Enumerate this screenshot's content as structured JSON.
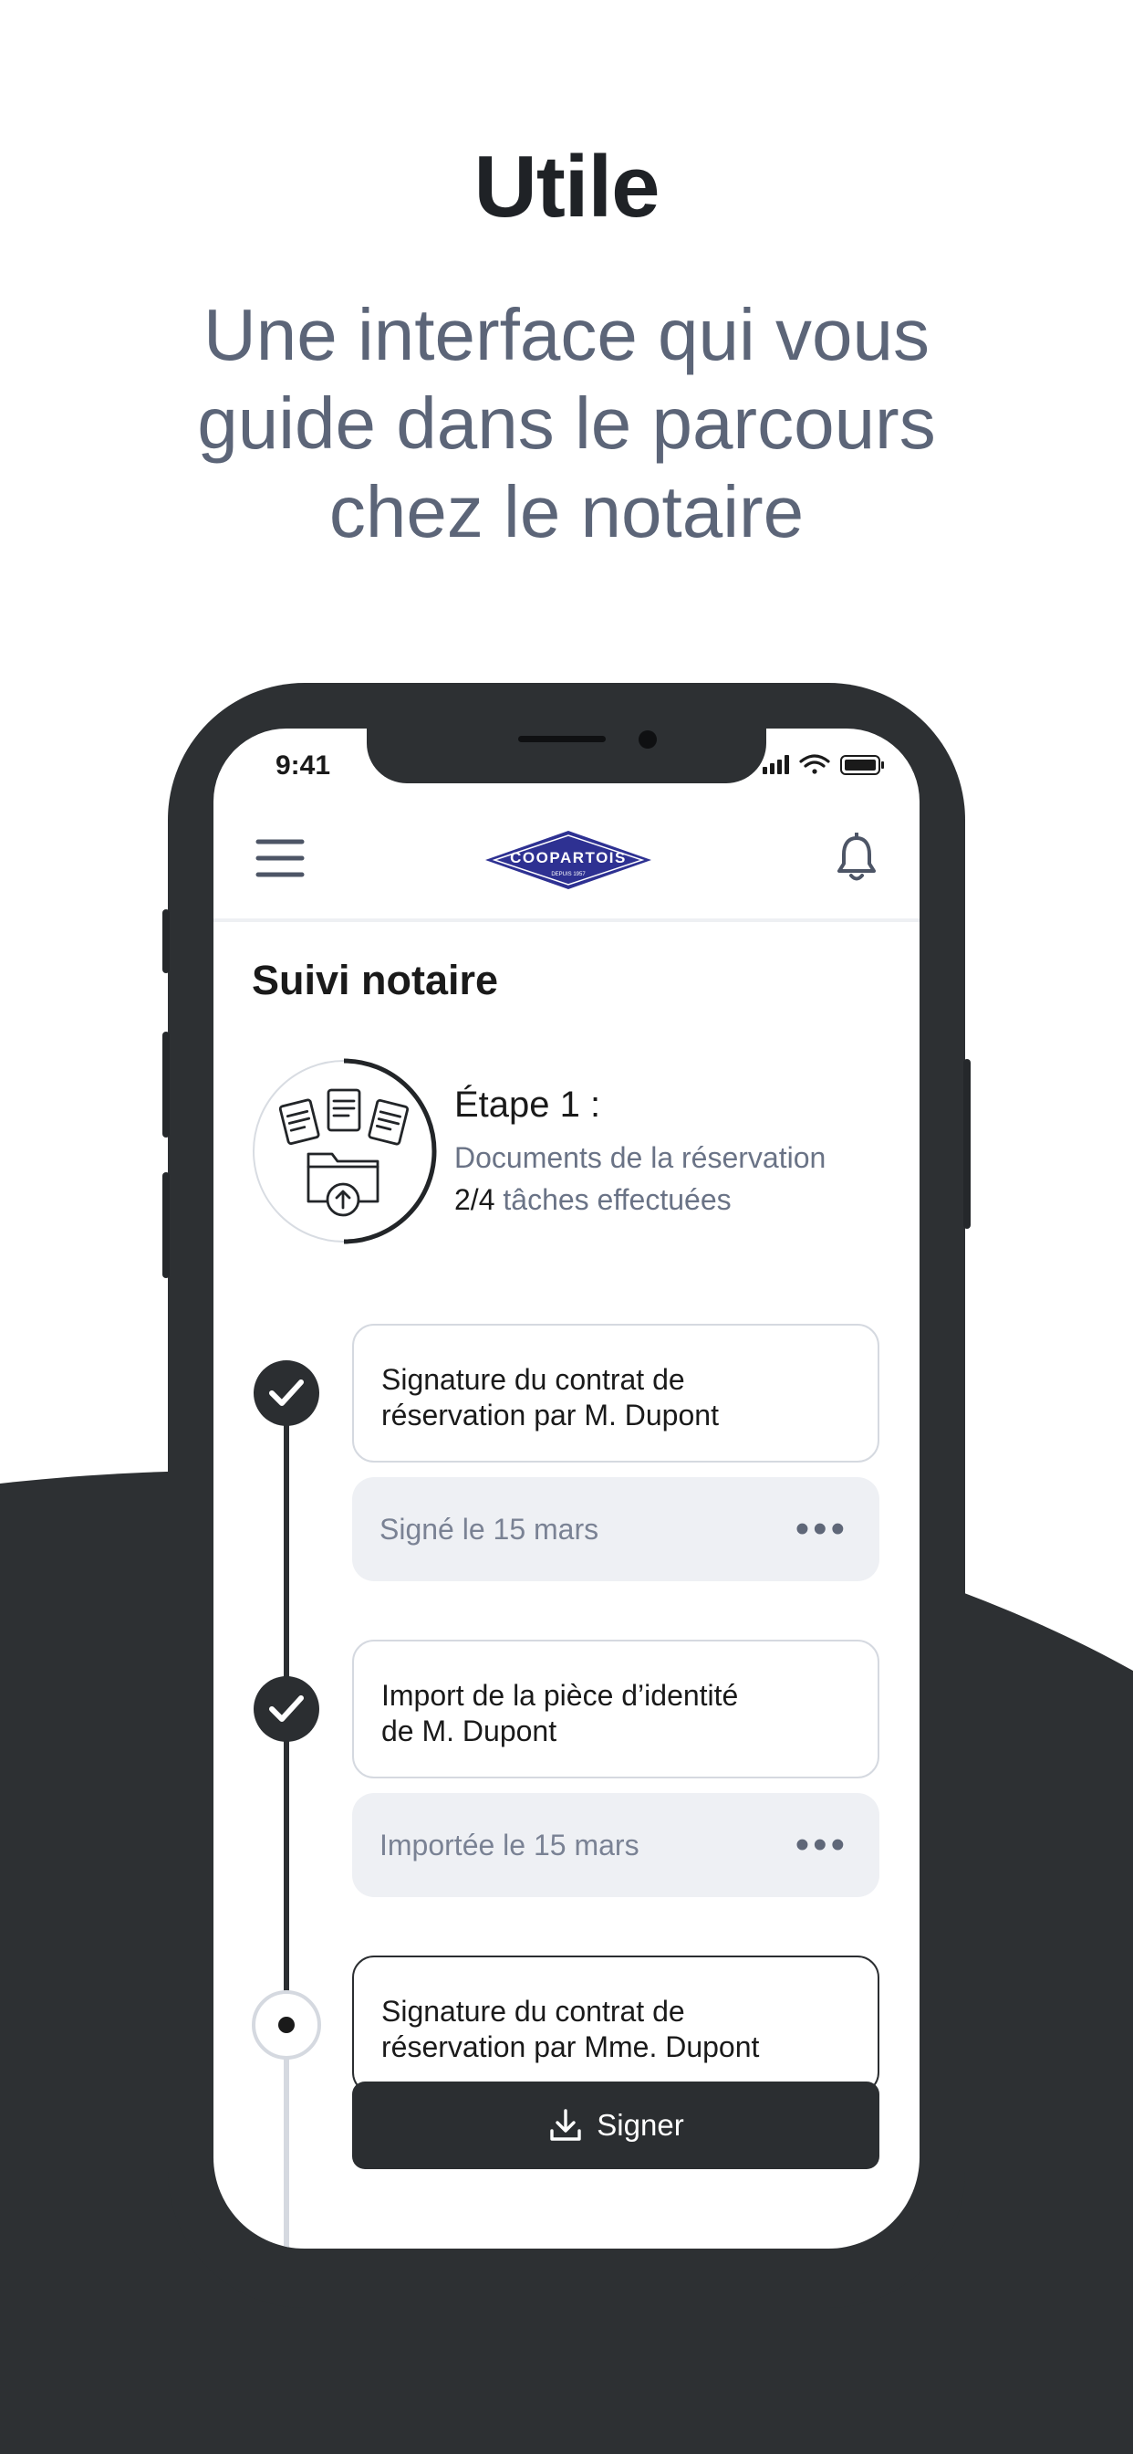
{
  "headline": "Utile",
  "subline": [
    "Une interface qui vous",
    "guide dans le parcours",
    "chez le notaire"
  ],
  "status_bar": {
    "time": "9:41"
  },
  "app": {
    "logo_text": "COOPARTOIS",
    "logo_sub": "DEPUIS 1957",
    "page_title": "Suivi notaire"
  },
  "step": {
    "title": "Étape 1 :",
    "subtitle": "Documents de la réservation",
    "progress_count": "2/4",
    "progress_label": "tâches effectuées",
    "progress_fraction": 0.5
  },
  "tasks": [
    {
      "line1": "Signature du contrat de",
      "line2": "réservation par M. Dupont",
      "status": "Signé le 15 mars",
      "done": true
    },
    {
      "line1": "Import de la pièce d’identité",
      "line2": "de M. Dupont",
      "status": "Importée le 15 mars",
      "done": true
    },
    {
      "line1": "Signature du contrat de",
      "line2": "réservation par Mme. Dupont",
      "status": "",
      "done": false
    }
  ],
  "actions": {
    "sign_label": "Signer"
  },
  "icons": [
    "menu-icon",
    "bell-icon",
    "check-icon",
    "more-icon",
    "download-icon",
    "documents-folder-icon"
  ],
  "colors": {
    "dark": "#2d3033",
    "accent_blue": "#2e3192",
    "muted_text": "#6a7386",
    "card_bg": "#eef0f4"
  }
}
